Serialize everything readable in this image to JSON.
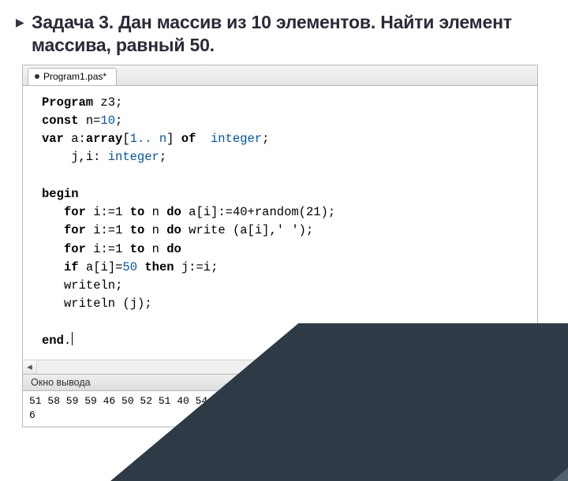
{
  "title": "Задача 3. Дан массив из 10 элементов. Найти элемент массива, равный 50.",
  "tab": {
    "filename": "Program1.pas*"
  },
  "code": {
    "l01_kw": "Program",
    "l01_rest": " z3;",
    "l02_kw": "const",
    "l02_rest": " n=",
    "l02_num": "10",
    "l02_semi": ";",
    "l03_kw": "var",
    "l03_a": " a:",
    "l03_arr": "array",
    "l03_br": "[",
    "l03_rng": "1.. n",
    "l03_br2": "] ",
    "l03_of": "of",
    "l03_sp": "  ",
    "l03_ty": "integer",
    "l03_semi": ";",
    "l04": "    j,i: ",
    "l04_ty": "integer",
    "l04_semi": ";",
    "l06_kw": "begin",
    "l07_for": "for",
    "l07_body": " i:=1 ",
    "l07_to": "to",
    "l07_n": " n ",
    "l07_do": "do",
    "l07_rest": " a[i]:=40+random(21);",
    "l08_for": "for",
    "l08_body": " i:=1 ",
    "l08_to": "to",
    "l08_n": " n ",
    "l08_do": "do",
    "l08_rest": " write (a[i],' ');",
    "l09_for": "for",
    "l09_body": " i:=1 ",
    "l09_to": "to",
    "l09_n": " n ",
    "l09_do": "do",
    "l09_rest": "",
    "l10_if": "if",
    "l10_mid": " a[i]=",
    "l10_num": "50",
    "l10_sp": " ",
    "l10_then": "then",
    "l10_rest": " j:=i;",
    "l11": "writeln;",
    "l12": "writeln (j);",
    "l14_kw": "end",
    "l14_dot": "."
  },
  "output": {
    "header": "Окно вывода",
    "line1": "51 58 59 59 46 50 52 51 40 54",
    "line2": "6"
  }
}
